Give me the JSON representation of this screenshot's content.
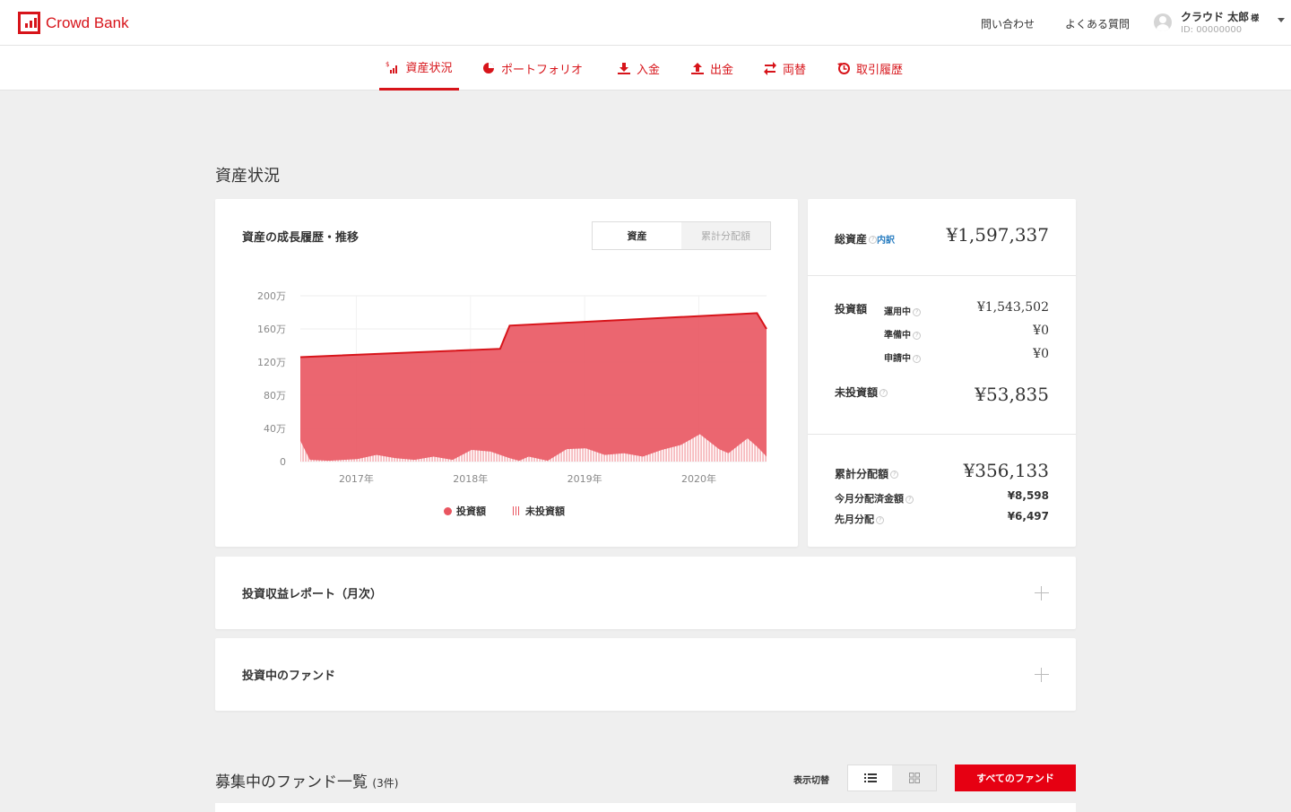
{
  "header": {
    "brand": "Crowd Bank",
    "links": [
      "問い合わせ",
      "よくある質問"
    ],
    "user_name": "クラウド 太郎",
    "user_suffix": "様",
    "user_id": "ID: 00000000"
  },
  "nav": {
    "tabs": [
      {
        "label": "資産状況",
        "icon": "asset-chart-icon",
        "active": true
      },
      {
        "label": "ポートフォリオ",
        "icon": "pie-chart-icon",
        "active": false
      },
      {
        "label": "入金",
        "icon": "download-icon",
        "active": false
      },
      {
        "label": "出金",
        "icon": "upload-icon",
        "active": false
      },
      {
        "label": "両替",
        "icon": "exchange-icon",
        "active": false
      },
      {
        "label": "取引履歴",
        "icon": "history-icon",
        "active": false
      }
    ]
  },
  "page_title": "資産状況",
  "chart_card": {
    "title": "資産の成長履歴・推移",
    "toggle": [
      "資産",
      "累計分配額"
    ]
  },
  "chart_data": {
    "type": "area",
    "ylabel": "",
    "xlabel": "",
    "y_ticks": [
      "200万",
      "160万",
      "120万",
      "80万",
      "40万",
      "0"
    ],
    "ylim": [
      0,
      2000000
    ],
    "x_ticks": [
      "2017年",
      "2018年",
      "2019年",
      "2020年"
    ],
    "legend": [
      "投資額",
      "未投資額"
    ],
    "grid": true,
    "series": [
      {
        "name": "投資額",
        "x": [
          "2016-09",
          "2018-06",
          "2018-07",
          "2020-09",
          "2020-10"
        ],
        "values": [
          1260000,
          1360000,
          1640000,
          1790000,
          1600000
        ]
      },
      {
        "name": "未投資額",
        "x": [
          "2016-09",
          "2016-10",
          "2016-12",
          "2017-03",
          "2017-05",
          "2017-07",
          "2017-09",
          "2017-11",
          "2018-01",
          "2018-03",
          "2018-05",
          "2018-07",
          "2018-08",
          "2018-09",
          "2018-11",
          "2019-01",
          "2019-03",
          "2019-05",
          "2019-07",
          "2019-09",
          "2019-11",
          "2020-01",
          "2020-03",
          "2020-05",
          "2020-06",
          "2020-08",
          "2020-09",
          "2020-10"
        ],
        "values": [
          250000,
          20000,
          10000,
          30000,
          80000,
          40000,
          20000,
          60000,
          20000,
          140000,
          120000,
          40000,
          10000,
          60000,
          10000,
          150000,
          160000,
          80000,
          100000,
          60000,
          140000,
          200000,
          330000,
          150000,
          100000,
          280000,
          180000,
          60000
        ]
      }
    ]
  },
  "summary": {
    "total_label": "総資産",
    "breakdown_link": "内訳",
    "total_value": "¥1,597,337",
    "invest_label": "投資額",
    "invest_rows": [
      {
        "label": "運用中",
        "value": "¥1,543,502"
      },
      {
        "label": "準備中",
        "value": "¥0"
      },
      {
        "label": "申請中",
        "value": "¥0"
      }
    ],
    "uninvested_label": "未投資額",
    "uninvested_value": "¥53,835",
    "cumulative_label": "累計分配額",
    "cumulative_value": "¥356,133",
    "this_month_label": "今月分配済金額",
    "this_month_value": "¥8,598",
    "last_month_label": "先月分配",
    "last_month_value": "¥6,497"
  },
  "accordions": [
    "投資収益レポート（月次）",
    "投資中のファンド"
  ],
  "funds": {
    "title": "募集中のファンド一覧",
    "count": "(3件)",
    "view_label": "表示切替",
    "all_button": "すべてのファンド"
  },
  "colors": {
    "brand": "#d7141a",
    "area": "#e95560",
    "button": "#e60012"
  }
}
